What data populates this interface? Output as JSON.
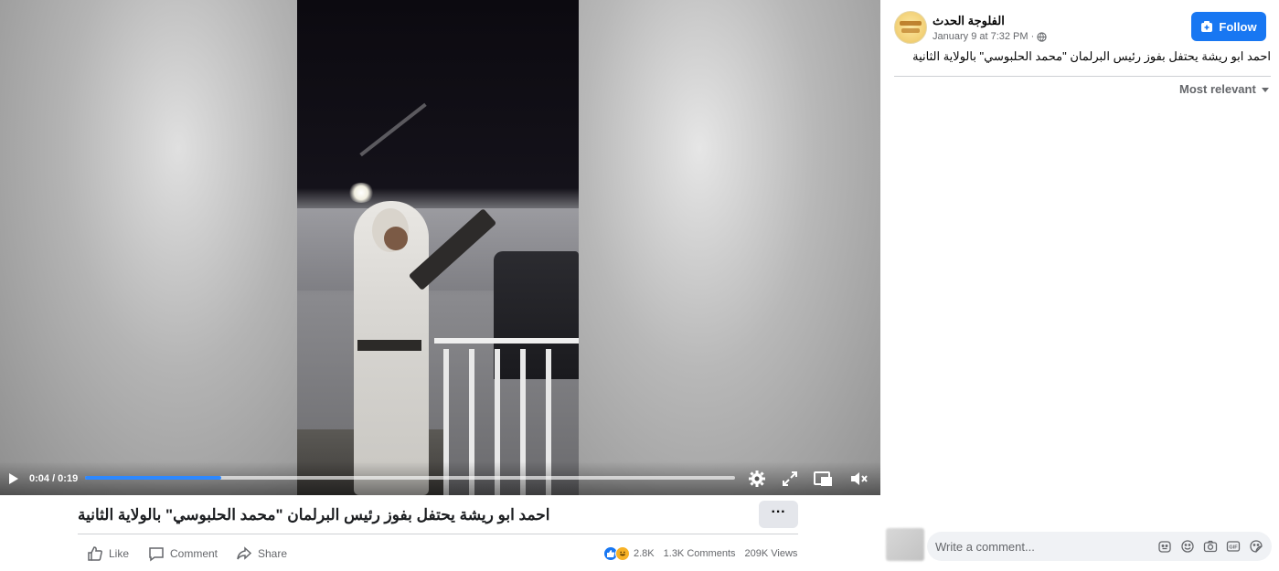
{
  "video": {
    "time": "0:04 / 0:19",
    "progress": 0.21
  },
  "post": {
    "title": "احمد ابو ريشة يحتفل بفوز رئيس البرلمان \"محمد الحلبوسي\" بالولاية الثانية",
    "more_label": "···",
    "actions": {
      "like": "Like",
      "comment": "Comment",
      "share": "Share"
    },
    "stats": {
      "reactions": "2.8K",
      "comments": "1.3K Comments",
      "views": "209K Views"
    }
  },
  "page": {
    "name": "الفلوجة الحدث",
    "timestamp": "January 9 at 7:32 PM",
    "meta_separator": "·",
    "follow_label": "Follow",
    "post_text": "احمد ابو ريشة يحتفل بفوز رئيس البرلمان \"محمد الحلبوسي\" بالولاية الثانية",
    "sort_label": "Most relevant"
  },
  "comment": {
    "placeholder": "Write a comment..."
  },
  "colors": {
    "accent": "#1877f2",
    "progress": "#2d88ff",
    "secondary_text": "#65676b"
  }
}
